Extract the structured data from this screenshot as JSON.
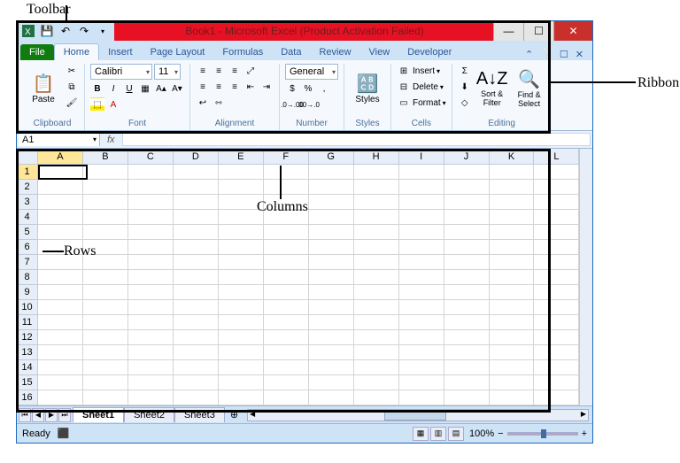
{
  "annotations": {
    "toolbar": "Toolbar",
    "ribbon": "Ribbon",
    "columns": "Columns",
    "rows": "Rows"
  },
  "title": "Book1 - Microsoft Excel (Product Activation Failed)",
  "tabs": {
    "file": "File",
    "home": "Home",
    "insert": "Insert",
    "pagelayout": "Page Layout",
    "formulas": "Formulas",
    "data": "Data",
    "review": "Review",
    "view": "View",
    "developer": "Developer"
  },
  "ribbon": {
    "clipboard": {
      "label": "Clipboard",
      "paste": "Paste"
    },
    "font": {
      "label": "Font",
      "name": "Calibri",
      "size": "11",
      "bold": "B",
      "italic": "I",
      "underline": "U"
    },
    "alignment": {
      "label": "Alignment"
    },
    "number": {
      "label": "Number",
      "format": "General"
    },
    "styles": {
      "label": "Styles",
      "btn": "Styles"
    },
    "cells": {
      "label": "Cells",
      "insert": "Insert",
      "delete": "Delete",
      "format": "Format"
    },
    "editing": {
      "label": "Editing",
      "sort": "Sort & Filter",
      "find": "Find & Select"
    }
  },
  "namebox": "A1",
  "fx": "fx",
  "columns": [
    "A",
    "B",
    "C",
    "D",
    "E",
    "F",
    "G",
    "H",
    "I",
    "J",
    "K",
    "L"
  ],
  "rows": [
    "1",
    "2",
    "3",
    "4",
    "5",
    "6",
    "7",
    "8",
    "9",
    "10",
    "11",
    "12",
    "13",
    "14",
    "15",
    "16"
  ],
  "sheets": {
    "s1": "Sheet1",
    "s2": "Sheet2",
    "s3": "Sheet3"
  },
  "status": {
    "ready": "Ready",
    "zoom": "100%"
  }
}
